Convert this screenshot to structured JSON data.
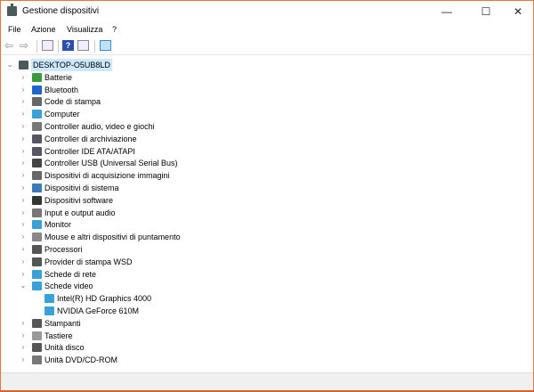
{
  "window": {
    "title": "Gestione dispositivi",
    "minimize": "—",
    "maximize": "☐",
    "close": "✕",
    "border_color": "#e8773c"
  },
  "menu": [
    "File",
    "Azione",
    "Visualizza",
    "?"
  ],
  "toolbar": [
    "back-icon",
    "forward-icon",
    "properties-icon",
    "help-icon",
    "update-driver-icon",
    "scan-hardware-icon"
  ],
  "tree": {
    "root": "DESKTOP-O5UB8LD",
    "categories": [
      {
        "label": "Batterie",
        "icon": "battery-icon",
        "color": "#3a9a3a"
      },
      {
        "label": "Bluetooth",
        "icon": "bluetooth-icon",
        "color": "#1a66cc"
      },
      {
        "label": "Code di stampa",
        "icon": "print-queue-icon",
        "color": "#666"
      },
      {
        "label": "Computer",
        "icon": "computer-icon",
        "color": "#3aa0d8"
      },
      {
        "label": "Controller audio, video e giochi",
        "icon": "audio-icon",
        "color": "#777"
      },
      {
        "label": "Controller di archiviazione",
        "icon": "storage-icon",
        "color": "#556"
      },
      {
        "label": "Controller IDE ATA/ATAPI",
        "icon": "ide-icon",
        "color": "#556"
      },
      {
        "label": "Controller USB (Universal Serial Bus)",
        "icon": "usb-icon",
        "color": "#444"
      },
      {
        "label": "Dispositivi di acquisizione immagini",
        "icon": "camera-icon",
        "color": "#666"
      },
      {
        "label": "Dispositivi di sistema",
        "icon": "system-icon",
        "color": "#3a7ab8"
      },
      {
        "label": "Dispositivi software",
        "icon": "software-icon",
        "color": "#333"
      },
      {
        "label": "Input e output audio",
        "icon": "speaker-icon",
        "color": "#777"
      },
      {
        "label": "Monitor",
        "icon": "monitor-icon",
        "color": "#3aa0d8"
      },
      {
        "label": "Mouse e altri dispositivi di puntamento",
        "icon": "mouse-icon",
        "color": "#888"
      },
      {
        "label": "Processori",
        "icon": "processor-icon",
        "color": "#555"
      },
      {
        "label": "Provider di stampa WSD",
        "icon": "printer-icon",
        "color": "#555"
      },
      {
        "label": "Schede di rete",
        "icon": "network-icon",
        "color": "#3aa0d8"
      },
      {
        "label": "Schede video",
        "icon": "display-adapter-icon",
        "color": "#3aa0d8",
        "expanded": true,
        "children": [
          "Intel(R) HD Graphics 4000",
          "NVIDIA GeForce 610M"
        ]
      },
      {
        "label": "Stampanti",
        "icon": "printer-icon",
        "color": "#555"
      },
      {
        "label": "Tastiere",
        "icon": "keyboard-icon",
        "color": "#999"
      },
      {
        "label": "Unità disco",
        "icon": "disk-icon",
        "color": "#555"
      },
      {
        "label": "Unità DVD/CD-ROM",
        "icon": "dvd-icon",
        "color": "#777"
      }
    ]
  }
}
